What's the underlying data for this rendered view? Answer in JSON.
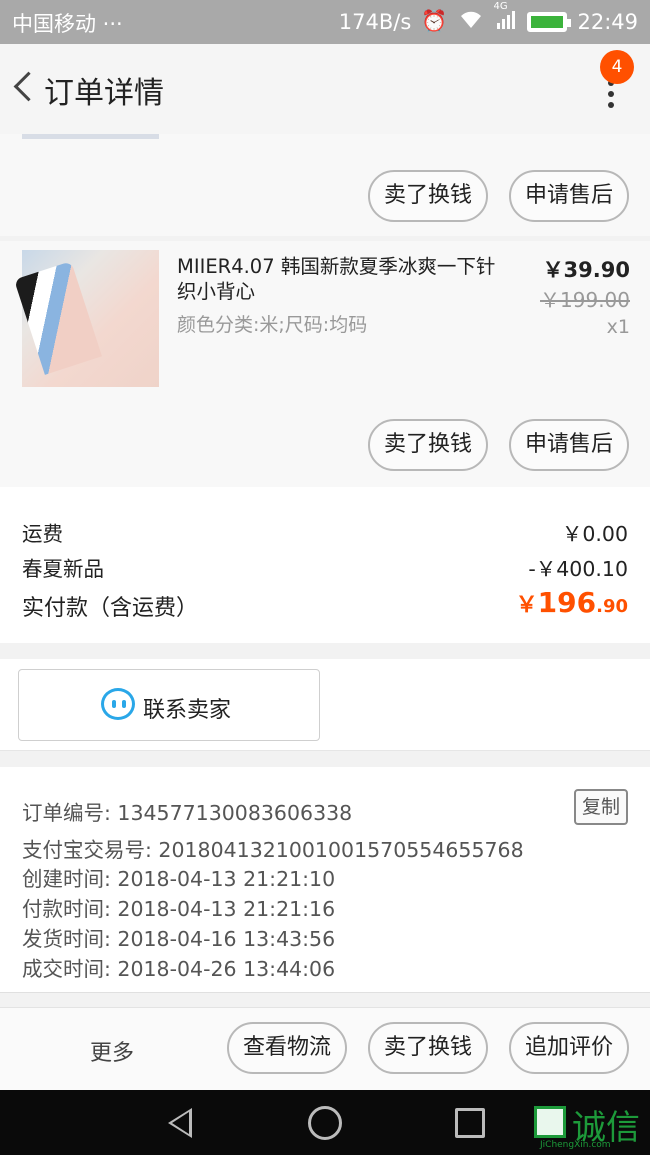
{
  "status_bar": {
    "carrier": "中国移动 ···",
    "speed": "174B/s",
    "network": "4G",
    "time": "22:49"
  },
  "header": {
    "title": "订单详情",
    "badge_count": "4"
  },
  "items": [
    {
      "actions": [
        "卖了换钱",
        "申请售后"
      ]
    },
    {
      "name": "MIIER4.07 韩国新款夏季冰爽一下针织小背心",
      "sku": "颜色分类:米;尺码:均码",
      "price": "￥39.90",
      "original_price": "￥199.00",
      "quantity": "x1",
      "actions": [
        "卖了换钱",
        "申请售后"
      ]
    }
  ],
  "summary": {
    "shipping_label": "运费",
    "shipping_value": "￥0.00",
    "discount_label": "春夏新品",
    "discount_value": "-￥400.10",
    "total_label": "实付款（含运费）",
    "total_currency": "￥",
    "total_int": "196",
    "total_dec": ".90"
  },
  "contact": {
    "label": "联系卖家"
  },
  "order_info": {
    "order_no": "订单编号: 134577130083606338",
    "copy_label": "复制",
    "alipay_no": "支付宝交易号: 2018041321001001570554655768",
    "created": "创建时间: 2018-04-13 21:21:10",
    "paid": "付款时间: 2018-04-13 21:21:16",
    "shipped": "发货时间: 2018-04-16 13:43:56",
    "completed": "成交时间: 2018-04-26 13:44:06"
  },
  "bottom_bar": {
    "more": "更多",
    "logistics": "查看物流",
    "sell": "卖了换钱",
    "review": "追加评价"
  },
  "watermark": {
    "text": "诚信",
    "site": "JiChengXin.com"
  },
  "colors": {
    "accent": "#ff5000",
    "contact_icon": "#2aa7e8"
  }
}
